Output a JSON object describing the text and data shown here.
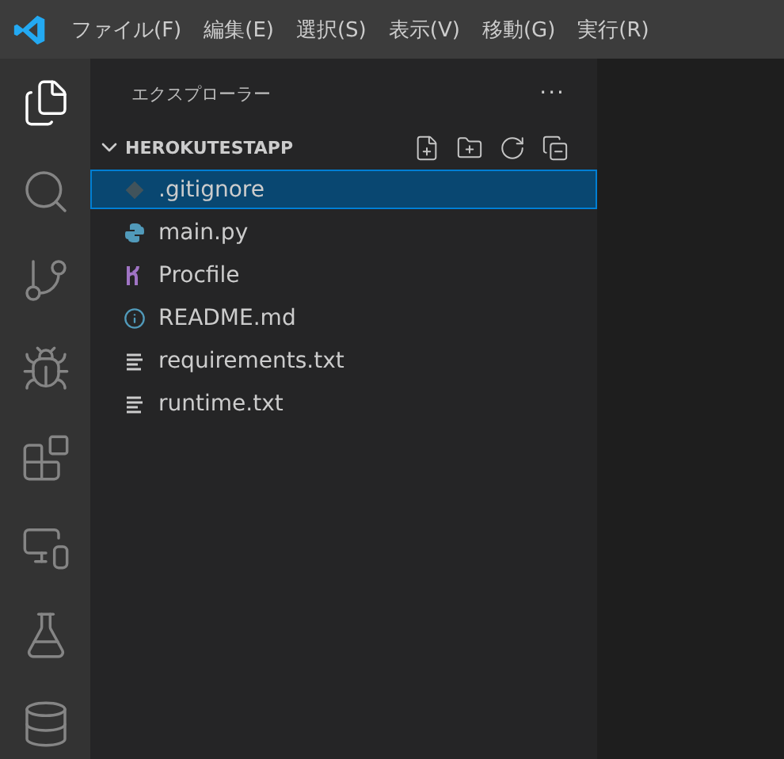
{
  "menu": [
    {
      "label": "ファイル(F)"
    },
    {
      "label": "編集(E)"
    },
    {
      "label": "選択(S)"
    },
    {
      "label": "表示(V)"
    },
    {
      "label": "移動(G)"
    },
    {
      "label": "実行(R)"
    }
  ],
  "activity_bar": [
    {
      "kind": "explorer",
      "selected": true
    },
    {
      "kind": "search",
      "selected": false
    },
    {
      "kind": "scm",
      "selected": false
    },
    {
      "kind": "debug",
      "selected": false
    },
    {
      "kind": "extensions",
      "selected": false
    },
    {
      "kind": "remote",
      "selected": false
    },
    {
      "kind": "testing",
      "selected": false
    },
    {
      "kind": "database",
      "selected": false
    }
  ],
  "sidebar": {
    "title": "エクスプローラー",
    "more": "···",
    "section": {
      "title": "HEROKUTESTAPP",
      "expanded": true,
      "files": [
        {
          "name": ".gitignore",
          "kind": "git",
          "selected": true
        },
        {
          "name": "main.py",
          "kind": "python",
          "selected": false
        },
        {
          "name": "Procfile",
          "kind": "heroku",
          "selected": false
        },
        {
          "name": "README.md",
          "kind": "info",
          "selected": false
        },
        {
          "name": "requirements.txt",
          "kind": "text",
          "selected": false
        },
        {
          "name": "runtime.txt",
          "kind": "text",
          "selected": false
        }
      ]
    }
  }
}
